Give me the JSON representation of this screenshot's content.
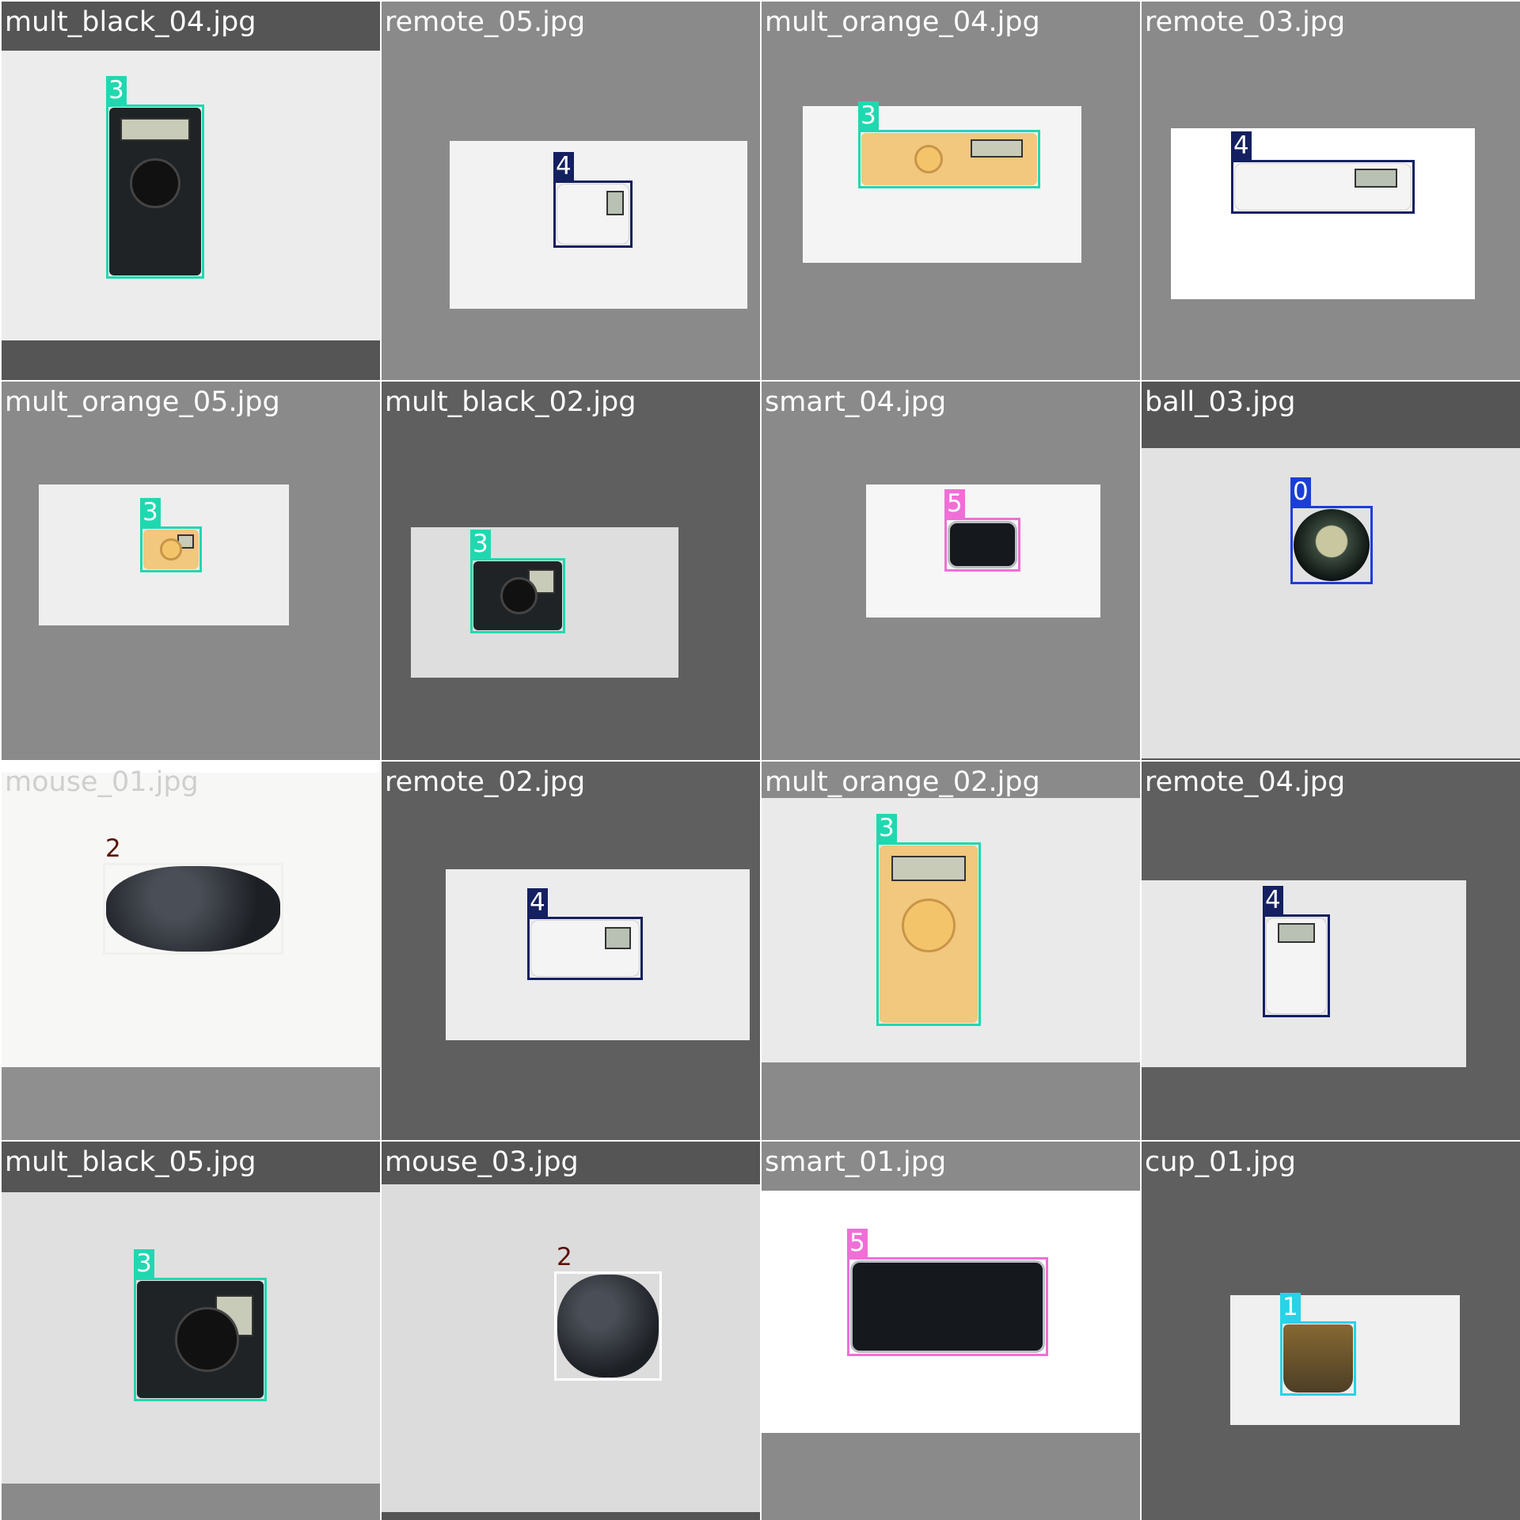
{
  "mosaic": {
    "tiles": [
      {
        "file": "mult_black_04.jpg",
        "label": "3",
        "object": "multimeter-black"
      },
      {
        "file": "remote_05.jpg",
        "label": "4",
        "object": "remote"
      },
      {
        "file": "mult_orange_04.jpg",
        "label": "3",
        "object": "multimeter-orange"
      },
      {
        "file": "remote_03.jpg",
        "label": "4",
        "object": "remote"
      },
      {
        "file": "mult_orange_05.jpg",
        "label": "3",
        "object": "multimeter-orange"
      },
      {
        "file": "mult_black_02.jpg",
        "label": "3",
        "object": "multimeter-black"
      },
      {
        "file": "smart_04.jpg",
        "label": "5",
        "object": "smartphone"
      },
      {
        "file": "ball_03.jpg",
        "label": "0",
        "object": "ball"
      },
      {
        "file": "mouse_01.jpg",
        "label": "2",
        "object": "mouse"
      },
      {
        "file": "remote_02.jpg",
        "label": "4",
        "object": "remote"
      },
      {
        "file": "mult_orange_02.jpg",
        "label": "3",
        "object": "multimeter-orange"
      },
      {
        "file": "remote_04.jpg",
        "label": "4",
        "object": "remote"
      },
      {
        "file": "mult_black_05.jpg",
        "label": "3",
        "object": "multimeter-black"
      },
      {
        "file": "mouse_03.jpg",
        "label": "2",
        "object": "mouse"
      },
      {
        "file": "smart_01.jpg",
        "label": "5",
        "object": "smartphone"
      },
      {
        "file": "cup_01.jpg",
        "label": "1",
        "object": "cup"
      }
    ]
  },
  "class_colors": {
    "0": "#1b3fd6",
    "1": "#28d3e6",
    "2": "#5a1208",
    "3": "#20d8b0",
    "4": "#142060",
    "5": "#ef6fd6"
  }
}
